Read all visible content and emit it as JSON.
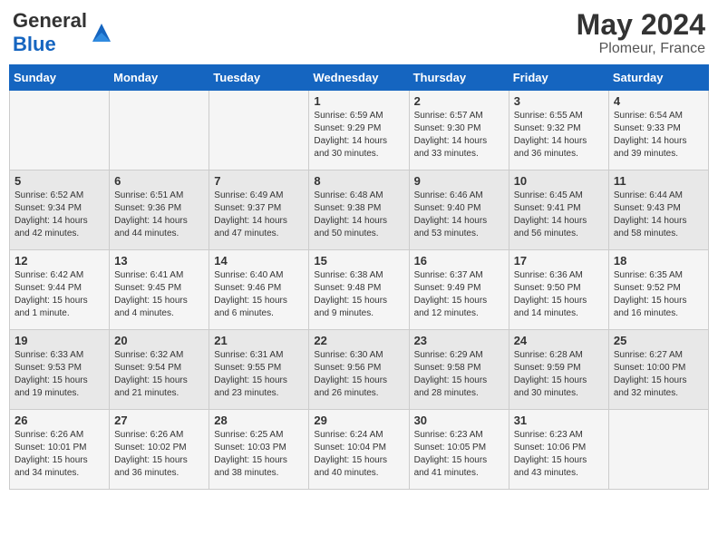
{
  "header": {
    "logo_general": "General",
    "logo_blue": "Blue",
    "month_year": "May 2024",
    "location": "Plomeur, France"
  },
  "days_of_week": [
    "Sunday",
    "Monday",
    "Tuesday",
    "Wednesday",
    "Thursday",
    "Friday",
    "Saturday"
  ],
  "weeks": [
    [
      {
        "day": "",
        "info": ""
      },
      {
        "day": "",
        "info": ""
      },
      {
        "day": "",
        "info": ""
      },
      {
        "day": "1",
        "info": "Sunrise: 6:59 AM\nSunset: 9:29 PM\nDaylight: 14 hours\nand 30 minutes."
      },
      {
        "day": "2",
        "info": "Sunrise: 6:57 AM\nSunset: 9:30 PM\nDaylight: 14 hours\nand 33 minutes."
      },
      {
        "day": "3",
        "info": "Sunrise: 6:55 AM\nSunset: 9:32 PM\nDaylight: 14 hours\nand 36 minutes."
      },
      {
        "day": "4",
        "info": "Sunrise: 6:54 AM\nSunset: 9:33 PM\nDaylight: 14 hours\nand 39 minutes."
      }
    ],
    [
      {
        "day": "5",
        "info": "Sunrise: 6:52 AM\nSunset: 9:34 PM\nDaylight: 14 hours\nand 42 minutes."
      },
      {
        "day": "6",
        "info": "Sunrise: 6:51 AM\nSunset: 9:36 PM\nDaylight: 14 hours\nand 44 minutes."
      },
      {
        "day": "7",
        "info": "Sunrise: 6:49 AM\nSunset: 9:37 PM\nDaylight: 14 hours\nand 47 minutes."
      },
      {
        "day": "8",
        "info": "Sunrise: 6:48 AM\nSunset: 9:38 PM\nDaylight: 14 hours\nand 50 minutes."
      },
      {
        "day": "9",
        "info": "Sunrise: 6:46 AM\nSunset: 9:40 PM\nDaylight: 14 hours\nand 53 minutes."
      },
      {
        "day": "10",
        "info": "Sunrise: 6:45 AM\nSunset: 9:41 PM\nDaylight: 14 hours\nand 56 minutes."
      },
      {
        "day": "11",
        "info": "Sunrise: 6:44 AM\nSunset: 9:43 PM\nDaylight: 14 hours\nand 58 minutes."
      }
    ],
    [
      {
        "day": "12",
        "info": "Sunrise: 6:42 AM\nSunset: 9:44 PM\nDaylight: 15 hours\nand 1 minute."
      },
      {
        "day": "13",
        "info": "Sunrise: 6:41 AM\nSunset: 9:45 PM\nDaylight: 15 hours\nand 4 minutes."
      },
      {
        "day": "14",
        "info": "Sunrise: 6:40 AM\nSunset: 9:46 PM\nDaylight: 15 hours\nand 6 minutes."
      },
      {
        "day": "15",
        "info": "Sunrise: 6:38 AM\nSunset: 9:48 PM\nDaylight: 15 hours\nand 9 minutes."
      },
      {
        "day": "16",
        "info": "Sunrise: 6:37 AM\nSunset: 9:49 PM\nDaylight: 15 hours\nand 12 minutes."
      },
      {
        "day": "17",
        "info": "Sunrise: 6:36 AM\nSunset: 9:50 PM\nDaylight: 15 hours\nand 14 minutes."
      },
      {
        "day": "18",
        "info": "Sunrise: 6:35 AM\nSunset: 9:52 PM\nDaylight: 15 hours\nand 16 minutes."
      }
    ],
    [
      {
        "day": "19",
        "info": "Sunrise: 6:33 AM\nSunset: 9:53 PM\nDaylight: 15 hours\nand 19 minutes."
      },
      {
        "day": "20",
        "info": "Sunrise: 6:32 AM\nSunset: 9:54 PM\nDaylight: 15 hours\nand 21 minutes."
      },
      {
        "day": "21",
        "info": "Sunrise: 6:31 AM\nSunset: 9:55 PM\nDaylight: 15 hours\nand 23 minutes."
      },
      {
        "day": "22",
        "info": "Sunrise: 6:30 AM\nSunset: 9:56 PM\nDaylight: 15 hours\nand 26 minutes."
      },
      {
        "day": "23",
        "info": "Sunrise: 6:29 AM\nSunset: 9:58 PM\nDaylight: 15 hours\nand 28 minutes."
      },
      {
        "day": "24",
        "info": "Sunrise: 6:28 AM\nSunset: 9:59 PM\nDaylight: 15 hours\nand 30 minutes."
      },
      {
        "day": "25",
        "info": "Sunrise: 6:27 AM\nSunset: 10:00 PM\nDaylight: 15 hours\nand 32 minutes."
      }
    ],
    [
      {
        "day": "26",
        "info": "Sunrise: 6:26 AM\nSunset: 10:01 PM\nDaylight: 15 hours\nand 34 minutes."
      },
      {
        "day": "27",
        "info": "Sunrise: 6:26 AM\nSunset: 10:02 PM\nDaylight: 15 hours\nand 36 minutes."
      },
      {
        "day": "28",
        "info": "Sunrise: 6:25 AM\nSunset: 10:03 PM\nDaylight: 15 hours\nand 38 minutes."
      },
      {
        "day": "29",
        "info": "Sunrise: 6:24 AM\nSunset: 10:04 PM\nDaylight: 15 hours\nand 40 minutes."
      },
      {
        "day": "30",
        "info": "Sunrise: 6:23 AM\nSunset: 10:05 PM\nDaylight: 15 hours\nand 41 minutes."
      },
      {
        "day": "31",
        "info": "Sunrise: 6:23 AM\nSunset: 10:06 PM\nDaylight: 15 hours\nand 43 minutes."
      },
      {
        "day": "",
        "info": ""
      }
    ]
  ]
}
